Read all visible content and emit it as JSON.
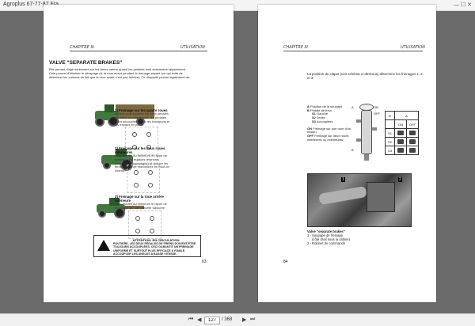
{
  "window": {
    "title": "Agroplus 67-77-87 Fra ...",
    "controls": "—  ☐  ✕"
  },
  "left_page": {
    "header_left": "CHAPITRE III",
    "header_right": "UTILISATION",
    "section_title": "VALVE \"SEPARATE BRAKES\"",
    "intro": "Elle permet d'agir seulement sur les freins arrière quand les pédales sont actionnées séparément. Cela permet d'éliminer le dérapage de la roue avant pendant le freinage séparé (ce qui évite de détériorer les cultures du fait que la roue avant n'est pas freinée). Ce dispositif permet également de:",
    "items": [
      {
        "heading": "1) Freinage sur les quatre roues",
        "text": "Quand vous écrasez les deux pédales de freins simultanément, les pédales étant accouplées Pour les transports et les travaux en pente."
      },
      {
        "heading": "2) Freinage sur les deux roues intérieures",
        "text": "Pour réduire au minimum le rayon de braquage en espaces restreints (chemins de campagne) et réduire les temps morts de manoeuvre en bout de champ."
      },
      {
        "heading": "3) Freinage sur la roue arrière intérieure",
        "text": "Pour réduire au minimum le rayon de braquage sur une parcelle labourée."
      }
    ],
    "warning_title": "ATTENTION: EN CIRCULATION",
    "warning_text": "ROUTIERE, LES DEUX PÉDALES DE FREINS DOIVENT ÊTRE TOUJOURS ACCOUPLÉES. CECI GARANTIT UN FREINAGE UNIFORME ET SURTOUT PLUS EFFICACE & FIABLE. ACCOUPLER LES ANGLES A BASSE VITESSE.",
    "page_number": "83"
  },
  "right_page": {
    "header_left": "CHAPITRE III",
    "header_right": "UTILISATION",
    "intro": "La position du clapet (voir schéma ci-dessous) détermine les freinages 1, 2 et 3.",
    "legend": [
      {
        "key": "A",
        "text": "Position de la soupape"
      },
      {
        "key": "B",
        "text": "Pédale de frein"
      },
      {
        "key": "S1",
        "text": "Gauche"
      },
      {
        "key": "S2",
        "text": "Droite"
      },
      {
        "key": "S3",
        "text": "Accouplées"
      },
      {
        "key": "ON",
        "text": "Freinage sur une roue d'un essieu"
      },
      {
        "key": "OFF",
        "text": "Freinage sur deux roues intérieures ou extérieures"
      }
    ],
    "valve_labels": {
      "on": "ON",
      "off": "OFF",
      "a": "A",
      "b": "B"
    },
    "table": {
      "header_a": "A",
      "header_b": "B",
      "col_on": "ON",
      "col_off": "OFF",
      "rows": [
        "S1",
        "S2",
        "S3"
      ]
    },
    "photo_markers": [
      "1",
      "2"
    ],
    "caption_title": "Valve \"separate brakes\"",
    "caption_lines": [
      "1 - Soupape de freinage",
      "(côté droit sous la cabine)",
      "2 - Robinet de commande"
    ],
    "page_number": "84"
  },
  "statusbar": {
    "first_label": "⏮",
    "prev_label": "◀",
    "current_page": "127",
    "total_pages": "/ 368",
    "next_label": "▶",
    "last_label": "⏭"
  }
}
